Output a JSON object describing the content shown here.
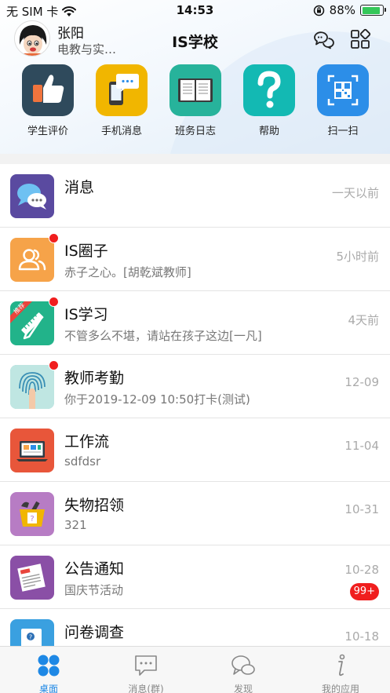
{
  "status": {
    "carrier": "无 SIM 卡",
    "time": "14:53",
    "battery": "88%",
    "battery_level": 0.88
  },
  "header": {
    "user_name": "张阳",
    "user_dept": "电教与实…",
    "title": "IS学校"
  },
  "quick_actions": [
    {
      "label": "学生评价",
      "icon": "thumbs-up-icon",
      "color": "#2f4a5c"
    },
    {
      "label": "手机消息",
      "icon": "phone-message-icon",
      "color": "#f1b600"
    },
    {
      "label": "班务日志",
      "icon": "open-book-icon",
      "color": "#27b39b"
    },
    {
      "label": "帮助",
      "icon": "question-mark-icon",
      "color": "#13b9b3"
    },
    {
      "label": "扫一扫",
      "icon": "qr-scan-icon",
      "color": "#2c8ee8"
    }
  ],
  "messages": [
    {
      "title": "消息",
      "subtitle": "",
      "time": "一天以前",
      "icon": "chat-bubbles-icon",
      "color": "#5a4aa0"
    },
    {
      "title": "IS圈子",
      "subtitle": "赤子之心。[胡乾斌教师]",
      "time": "5小时前",
      "icon": "people-circle-icon",
      "color": "#f6a349"
    },
    {
      "title": "IS学习",
      "subtitle": "不管多么不堪，请站在孩子这边[一凡]",
      "time": "4天前",
      "icon": "pencil-ruler-icon",
      "color": "#22b38a",
      "tag": "推荐"
    },
    {
      "title": "教师考勤",
      "subtitle": "你于2019-12-09 10:50打卡(测试)",
      "time": "12-09",
      "icon": "fingerprint-icon",
      "color": "#9fd6d6"
    },
    {
      "title": "工作流",
      "subtitle": "sdfdsr",
      "time": "11-04",
      "icon": "laptop-workflow-icon",
      "color": "#e8563a"
    },
    {
      "title": "失物招领",
      "subtitle": "321",
      "time": "10-31",
      "icon": "lost-found-bag-icon",
      "color": "#b77cc4"
    },
    {
      "title": "公告通知",
      "subtitle": "国庆节活动",
      "time": "10-28",
      "icon": "newspaper-icon",
      "color": "#8a4fa6",
      "badge": "99+"
    },
    {
      "title": "问卷调查",
      "subtitle": "",
      "time": "10-18",
      "icon": "survey-doc-icon",
      "color": "#3aa0e0"
    }
  ],
  "tabs": [
    {
      "label": "桌面",
      "icon": "desktop-grid-icon"
    },
    {
      "label": "消息(群)",
      "icon": "group-message-icon"
    },
    {
      "label": "发现",
      "icon": "discover-bubbles-icon"
    },
    {
      "label": "我的应用",
      "icon": "info-app-icon"
    }
  ],
  "colors": {
    "accent": "#1e88e5",
    "badge_red": "#f01e1e"
  }
}
